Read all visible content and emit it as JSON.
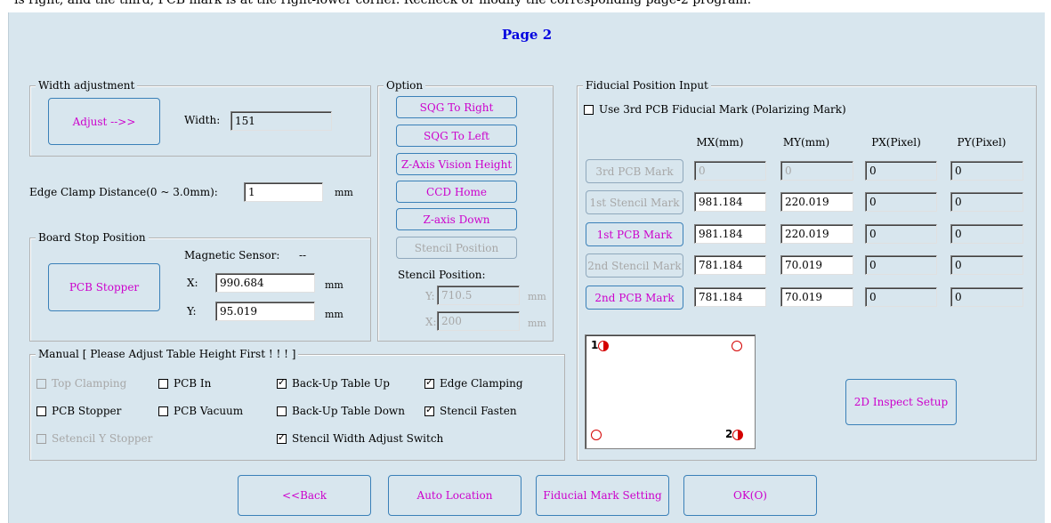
{
  "top_strip_text": "is right, and the third, PCB mark is at the right-lower corner. Recheck or modify the corresponding page-2 program.",
  "page_title": "Page 2",
  "width_adjustment": {
    "legend": "Width adjustment",
    "adjust_button": "Adjust -->>",
    "width_label": "Width:",
    "width_value": "151"
  },
  "edge_clamp": {
    "label": "Edge Clamp Distance(0 ~ 3.0mm):",
    "value": "1",
    "unit": "mm"
  },
  "board_stop": {
    "legend": "Board Stop Position",
    "stopper_button": "PCB Stopper",
    "sensor_label": "Magnetic Sensor:",
    "sensor_value": "--",
    "x_label": "X:",
    "x_value": "990.684",
    "x_unit": "mm",
    "y_label": "Y:",
    "y_value": "95.019",
    "y_unit": "mm"
  },
  "option": {
    "legend": "Option",
    "buttons": [
      "SQG To Right",
      "SQG To Left",
      "Z-Axis Vision Height",
      "CCD Home",
      "Z-axis Down",
      "Stencil Position"
    ],
    "stencil_pos_label": "Stencil Position:",
    "y_label": "Y:",
    "y_value": "710.5",
    "x_label": "X:",
    "x_value": "200",
    "unit": "mm"
  },
  "manual": {
    "legend": "Manual  [ Please Adjust Table Height First ! ! ! ]",
    "items": [
      {
        "label": "Top Clamping",
        "checked": false,
        "disabled": true
      },
      {
        "label": "PCB In",
        "checked": false,
        "disabled": false
      },
      {
        "label": "Back-Up Table Up",
        "checked": true,
        "disabled": false
      },
      {
        "label": "Edge Clamping",
        "checked": true,
        "disabled": false
      },
      {
        "label": "PCB Stopper",
        "checked": false,
        "disabled": false
      },
      {
        "label": "PCB Vacuum",
        "checked": false,
        "disabled": false
      },
      {
        "label": "Back-Up Table Down",
        "checked": false,
        "disabled": false
      },
      {
        "label": "Stencil Fasten",
        "checked": true,
        "disabled": false
      },
      {
        "label": "Setencil Y Stopper",
        "checked": false,
        "disabled": true
      },
      {
        "label": "Stencil Width Adjust Switch",
        "checked": true,
        "disabled": false
      }
    ]
  },
  "fiducial": {
    "legend": "Fiducial Position Input",
    "use3rd_label": "Use 3rd PCB Fiducial Mark (Polarizing Mark)",
    "use3rd_checked": false,
    "columns": [
      "MX(mm)",
      "MY(mm)",
      "PX(Pixel)",
      "PY(Pixel)"
    ],
    "rows": [
      {
        "button": "3rd PCB Mark",
        "disabled": true,
        "mx": "0",
        "my": "0",
        "px": "0",
        "py": "0"
      },
      {
        "button": "1st Stencil Mark",
        "disabled": true,
        "mx": "981.184",
        "my": "220.019",
        "px": "0",
        "py": "0"
      },
      {
        "button": "1st PCB Mark",
        "disabled": false,
        "mx": "981.184",
        "my": "220.019",
        "px": "0",
        "py": "0"
      },
      {
        "button": "2nd Stencil Mark",
        "disabled": true,
        "mx": "781.184",
        "my": "70.019",
        "px": "0",
        "py": "0"
      },
      {
        "button": "2nd PCB Mark",
        "disabled": false,
        "mx": "781.184",
        "my": "70.019",
        "px": "0",
        "py": "0"
      }
    ],
    "preview_mark1": "1",
    "preview_mark2": "2",
    "inspect_button": "2D  Inspect Setup"
  },
  "bottom_buttons": {
    "back": "<<Back",
    "auto_location": "Auto Location",
    "fiducial_setting": "Fiducial Mark Setting",
    "ok": "OK(O)"
  },
  "colors": {
    "panel_bg": "#d8e6ee",
    "button_text": "#cc00cc",
    "title": "#0000e0",
    "mark": "#d40000"
  }
}
